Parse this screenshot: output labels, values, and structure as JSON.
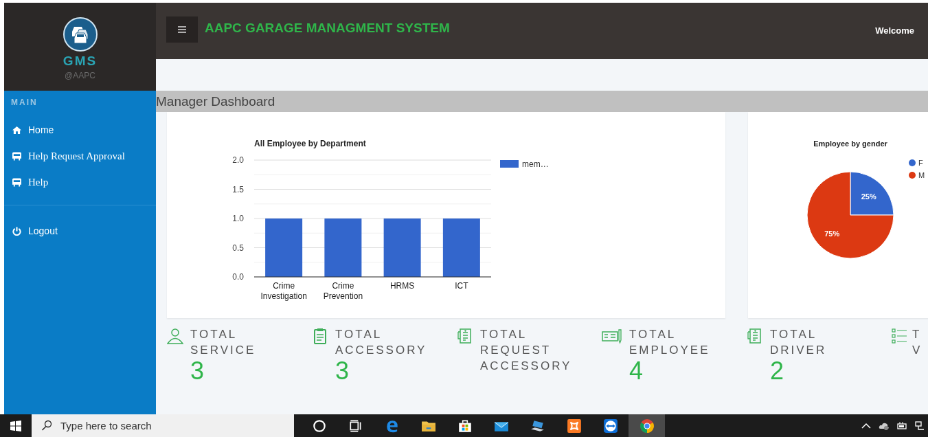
{
  "sidebar": {
    "brand": "GMS",
    "subtitle": "@AAPC",
    "section": "MAIN",
    "items": [
      {
        "label": "Home",
        "kind": "home"
      },
      {
        "label": "Help Request Approval",
        "kind": "bus"
      },
      {
        "label": "Help",
        "kind": "bus"
      }
    ],
    "footer_items": [
      {
        "label": "Logout",
        "kind": "power"
      }
    ]
  },
  "header": {
    "title": "AAPC GARAGE MANAGMENT SYSTEM",
    "welcome": "Welcome"
  },
  "page_title": "Manager Dashboard",
  "department_chart": {
    "chart_data": {
      "type": "bar",
      "title": "All Employee by Department",
      "categories": [
        "Crime Investigation",
        "Crime Prevention",
        "HRMS",
        "ICT"
      ],
      "series": [
        {
          "name": "mem…",
          "color": "#3366cc",
          "values": [
            1,
            1,
            1,
            1
          ]
        }
      ],
      "grid": true,
      "legend": true,
      "ylim": [
        0,
        2
      ],
      "yticks": [
        {
          "value": 0,
          "label": "0.0"
        },
        {
          "value": 0.5,
          "label": "0.5"
        },
        {
          "value": 1,
          "label": "1.0"
        },
        {
          "value": 1.5,
          "label": "1.5"
        },
        {
          "value": 2,
          "label": "2.0"
        }
      ]
    }
  },
  "gender_chart": {
    "chart_data": {
      "type": "pie",
      "title": "Employee by gender",
      "categories": [
        "F",
        "M"
      ],
      "values": [
        25,
        75
      ],
      "colors": [
        "#3366cc",
        "#dc3912"
      ],
      "legend": true,
      "value_labels": [
        "25%",
        "75%"
      ]
    }
  },
  "stats": [
    {
      "kind": "person",
      "label": [
        "TOTAL",
        "SERVICE"
      ],
      "value": "3"
    },
    {
      "kind": "clipboard",
      "label": [
        "TOTAL",
        "ACCESSORY"
      ],
      "value": "3"
    },
    {
      "kind": "receipt",
      "label": [
        "TOTAL",
        "REQUEST",
        "ACCESSORY"
      ]
    },
    {
      "kind": "card",
      "label": [
        "TOTAL",
        "EMPLOYEE"
      ],
      "value": "4"
    },
    {
      "kind": "receipt",
      "label": [
        "TOTAL",
        "DRIVER"
      ],
      "value": "2"
    },
    {
      "kind": "list",
      "label": [
        "T",
        "V"
      ]
    }
  ],
  "taskbar": {
    "search_placeholder": "Type here to search",
    "apps": [
      {
        "kind": "cortana",
        "selected": false
      },
      {
        "kind": "taskview",
        "selected": false
      },
      {
        "kind": "edge",
        "selected": false
      },
      {
        "kind": "folder",
        "selected": false
      },
      {
        "kind": "store",
        "selected": false
      },
      {
        "kind": "mail",
        "selected": false
      },
      {
        "kind": "laptop",
        "selected": false
      },
      {
        "kind": "xampp",
        "selected": false
      },
      {
        "kind": "teamviewer",
        "selected": false
      },
      {
        "kind": "chrome",
        "selected": true
      }
    ]
  }
}
